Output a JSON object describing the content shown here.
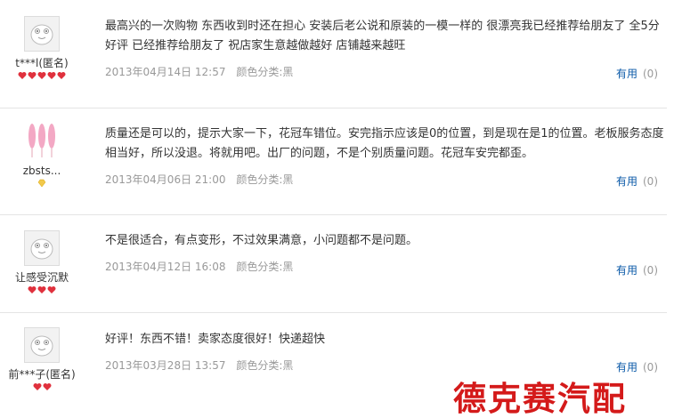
{
  "reviews": [
    {
      "user": "t***l(匿名)",
      "avatar": "default-avatar-icon",
      "badge": [
        "heart-icon",
        "heart-icon",
        "heart-icon",
        "heart-icon",
        "heart-icon"
      ],
      "text": "最高兴的一次购物 东西收到时还在担心 安装后老公说和原装的一模一样的 很漂亮我已经推荐给朋友了 全5分好评 已经推荐给朋友了 祝店家生意越做越好 店铺越来越旺",
      "date": "2013年04月14日 12:57",
      "spec": "颜色分类:黑",
      "useful_label": "有用",
      "useful_count": "(0)"
    },
    {
      "user": "zbsts...",
      "avatar": "feather-avatar-icon",
      "badge": [
        "diamond-icon"
      ],
      "text": "质量还是可以的，提示大家一下，花冠车错位。安完指示应该是0的位置，到是现在是1的位置。老板服务态度相当好，所以没退。将就用吧。出厂的问题，不是个别质量问题。花冠车安完都歪。",
      "date": "2013年04月06日 21:00",
      "spec": "颜色分类:黑",
      "useful_label": "有用",
      "useful_count": "(0)"
    },
    {
      "user": "让感受沉默",
      "avatar": "default-avatar-icon",
      "badge": [
        "heart-icon",
        "heart-icon",
        "heart-icon"
      ],
      "text": "不是很适合，有点变形，不过效果满意，小问题都不是问题。",
      "date": "2013年04月12日 16:08",
      "spec": "颜色分类:黑",
      "useful_label": "有用",
      "useful_count": "(0)"
    },
    {
      "user": "前***子(匿名)",
      "avatar": "default-avatar-icon",
      "badge": [
        "heart-icon",
        "heart-icon"
      ],
      "text": "好评！东西不错！卖家态度很好！快递超快",
      "date": "2013年03月28日 13:57",
      "spec": "颜色分类:黑",
      "useful_label": "有用",
      "useful_count": "(0)"
    }
  ],
  "watermark": "德克赛汽配",
  "colors": {
    "link": "#0b5aa8",
    "meta": "#999999",
    "heart": "#e0313d",
    "watermark": "#d41a1a"
  }
}
